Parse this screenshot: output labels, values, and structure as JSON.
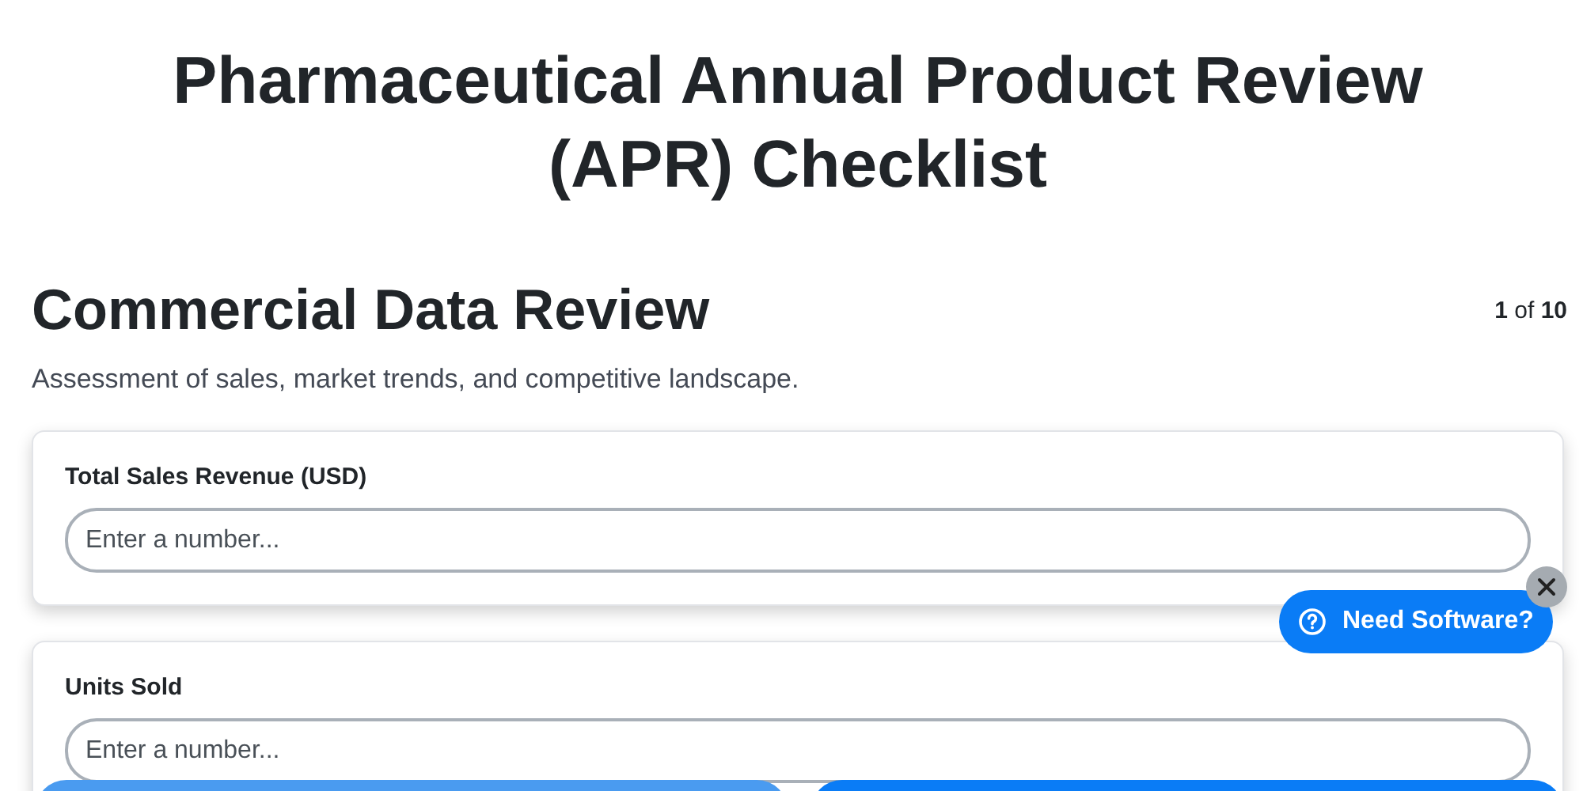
{
  "title": "Pharmaceutical Annual Product Review (APR) Checklist",
  "section": {
    "heading": "Commercial Data Review",
    "counter": "**1** of **10**",
    "description": "Assessment of sales, market trends, and competitive landscape."
  },
  "fields": [
    {
      "label": "Total Sales Revenue (USD)",
      "placeholder": "Enter a number..."
    },
    {
      "label": "Units Sold",
      "placeholder": "Enter a number..."
    }
  ],
  "help_button": {
    "label": "Need Software?"
  },
  "nav_buttons": [
    {
      "kind": "secondary"
    },
    {
      "kind": "primary"
    }
  ]
}
